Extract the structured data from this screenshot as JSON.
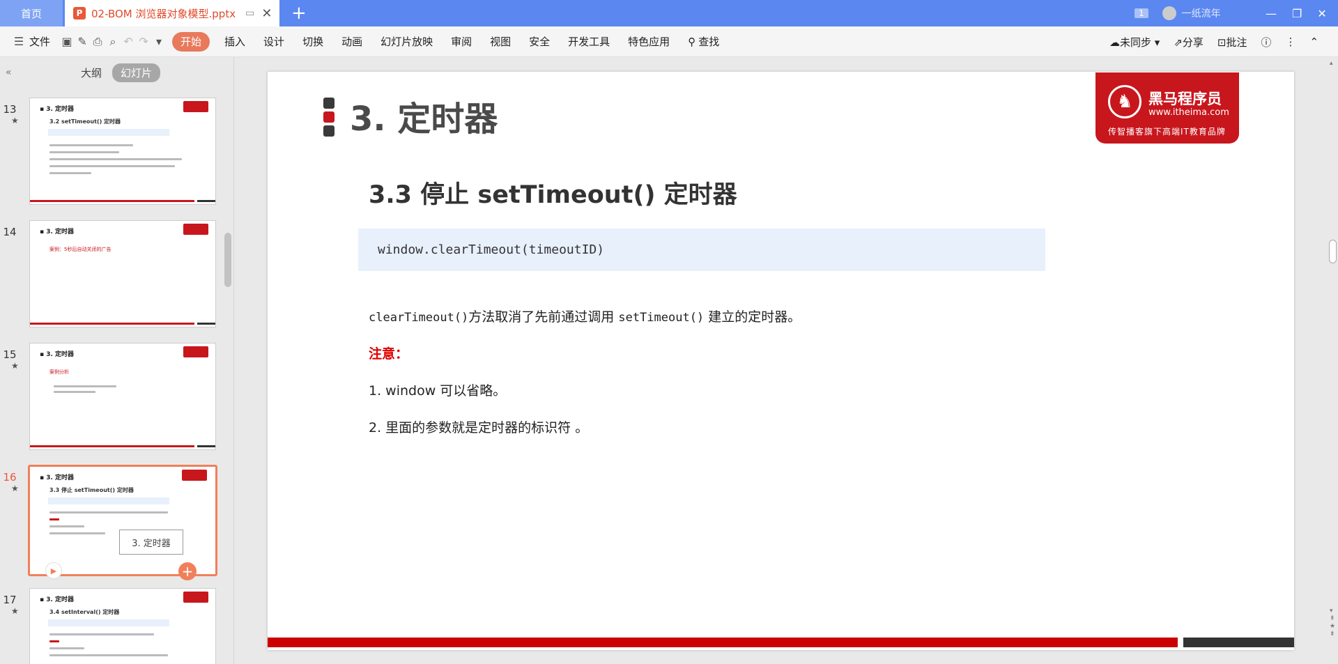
{
  "titlebar": {
    "home_tab": "首页",
    "doc_tab": "02-BOM 浏览器对象模型.pptx",
    "page_count": "1",
    "user": "一纸流年"
  },
  "ribbon": {
    "file": "文件",
    "tabs": [
      "开始",
      "插入",
      "设计",
      "切换",
      "动画",
      "幻灯片放映",
      "审阅",
      "视图",
      "安全",
      "开发工具",
      "特色应用"
    ],
    "search": "查找",
    "sync": "未同步",
    "share": "分享",
    "comment": "批注"
  },
  "panel": {
    "tab_outline": "大纲",
    "tab_slides": "幻灯片",
    "slides": [
      {
        "num": "13",
        "title": "3. 定时器",
        "subtitle": "3.2 setTimeout() 定时器"
      },
      {
        "num": "14",
        "title": "3. 定时器",
        "subtitle": "案例：5秒后自动关闭的广告"
      },
      {
        "num": "15",
        "title": "3. 定时器",
        "subtitle": "案例分析"
      },
      {
        "num": "16",
        "title": "3. 定时器",
        "subtitle": "3.3 停止 setTimeout() 定时器"
      },
      {
        "num": "17",
        "title": "3. 定时器",
        "subtitle": "3.4 setInterval() 定时器"
      }
    ],
    "tooltip": "3. 定时器"
  },
  "slide": {
    "title": "3. 定时器",
    "logo_name": "黑马程序员",
    "logo_url": "www.itheima.com",
    "logo_tagline": "传智播客旗下高端IT教育品牌",
    "heading": "3.3 停止 setTimeout() 定时器",
    "code": "window.clearTimeout(timeoutID)",
    "desc_code1": "clearTimeout()",
    "desc_text1": "方法取消了先前通过调用 ",
    "desc_code2": "setTimeout()",
    "desc_text2": " 建立的定时器。",
    "note": "注意：",
    "point1": "1. window 可以省略。",
    "point2": "2. 里面的参数就是定时器的标识符 。"
  },
  "colors": {
    "accent": "#c8161d",
    "ribbon_active": "#e8795a",
    "title_bar": "#5b87f0"
  }
}
